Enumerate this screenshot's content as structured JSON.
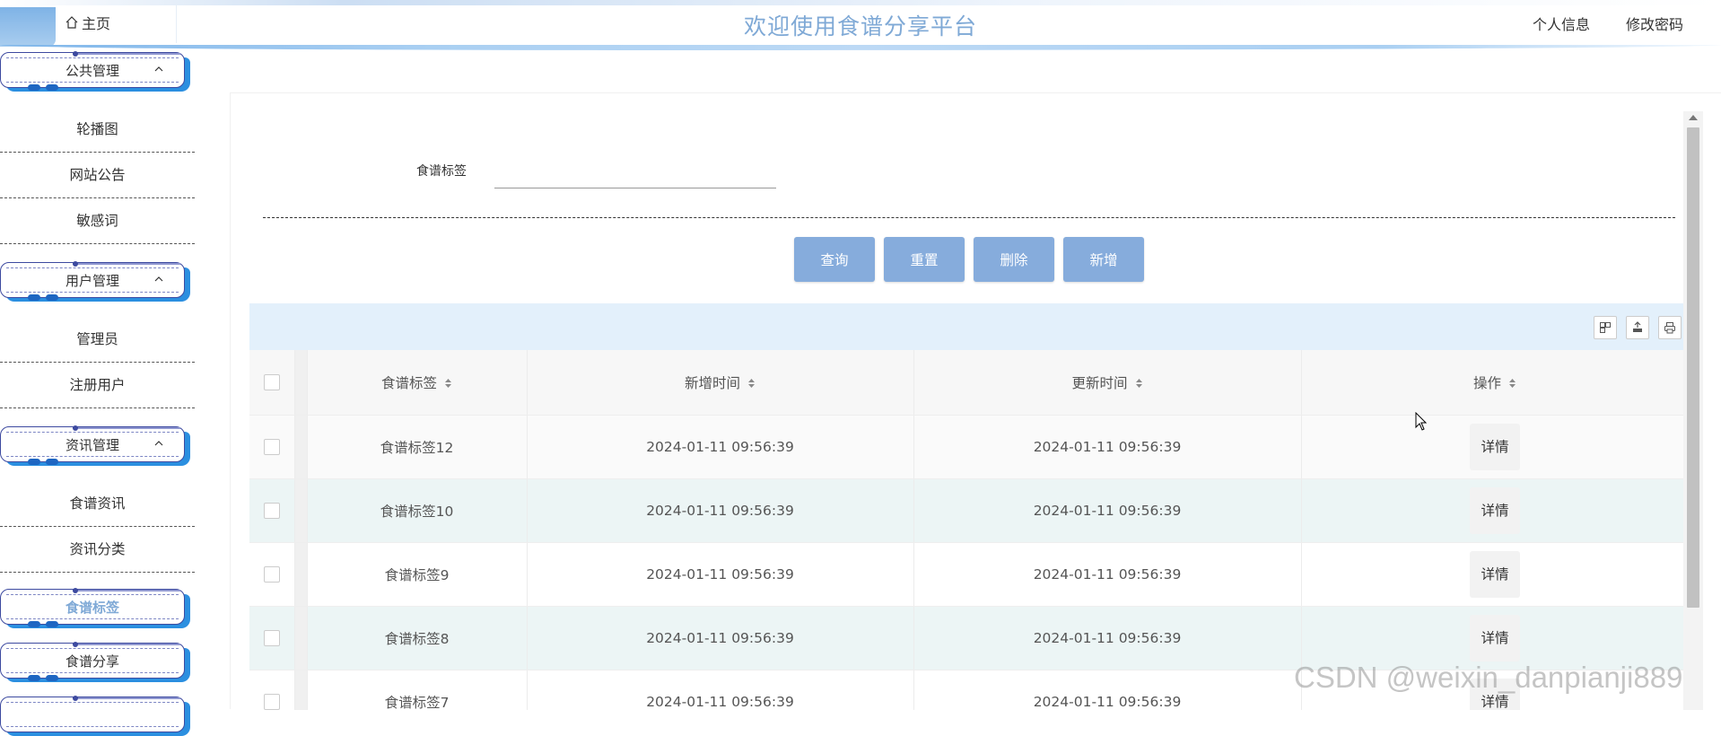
{
  "header": {
    "home_label": "主页",
    "title": "欢迎使用食谱分享平台",
    "nav": [
      "个人信息",
      "修改密码"
    ]
  },
  "sidebar": {
    "groups": [
      {
        "label": "公共管理",
        "items": [
          "轮播图",
          "网站公告",
          "敏感词"
        ]
      },
      {
        "label": "用户管理",
        "items": [
          "管理员",
          "注册用户"
        ]
      },
      {
        "label": "资讯管理",
        "items": [
          "食谱资讯",
          "资讯分类"
        ]
      }
    ],
    "active_item": "食谱标签",
    "more_items": [
      "食谱分享"
    ]
  },
  "search": {
    "label": "食谱标签",
    "value": ""
  },
  "buttons": {
    "query": "查询",
    "reset": "重置",
    "delete": "删除",
    "add": "新增"
  },
  "table": {
    "columns": [
      "食谱标签",
      "新增时间",
      "更新时间",
      "操作"
    ],
    "rows": [
      {
        "tag": "食谱标签12",
        "created": "2024-01-11 09:56:39",
        "updated": "2024-01-11 09:56:39",
        "action": "详情"
      },
      {
        "tag": "食谱标签10",
        "created": "2024-01-11 09:56:39",
        "updated": "2024-01-11 09:56:39",
        "action": "详情"
      },
      {
        "tag": "食谱标签9",
        "created": "2024-01-11 09:56:39",
        "updated": "2024-01-11 09:56:39",
        "action": "详情"
      },
      {
        "tag": "食谱标签8",
        "created": "2024-01-11 09:56:39",
        "updated": "2024-01-11 09:56:39",
        "action": "详情"
      },
      {
        "tag": "食谱标签7",
        "created": "2024-01-11 09:56:39",
        "updated": "2024-01-11 09:56:39",
        "action": "详情"
      }
    ]
  },
  "toolbar_icons": [
    "column-filter-icon",
    "export-icon",
    "print-icon"
  ],
  "watermark": "CSDN @weixin_danpianji889",
  "colors": {
    "accent": "#86acdc",
    "title": "#7fa9d6",
    "group_shadow": "#2b8fe0",
    "group_border": "#3d4aa0",
    "toolbar_bg": "#e3f0fb",
    "row_alt": "#ecf5f5"
  }
}
